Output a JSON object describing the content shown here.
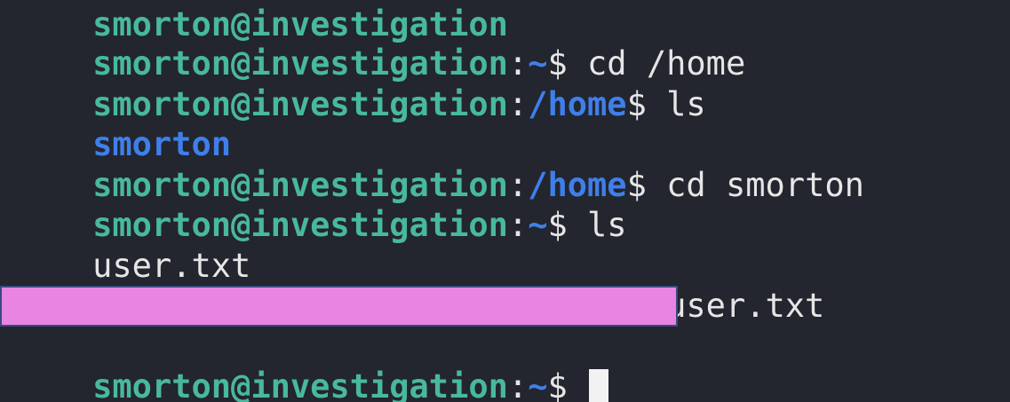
{
  "prompt": {
    "user_host": "smorton@investigation",
    "colon": ":",
    "dollar": "$"
  },
  "lines": [
    {
      "path": "~",
      "cmd": " cd /home"
    },
    {
      "path": "/home",
      "cmd": " ls"
    },
    {
      "output": "smorton"
    },
    {
      "path": "/home",
      "cmd": " cd smorton"
    },
    {
      "path": "~",
      "cmd": " ls"
    },
    {
      "output": "user.txt"
    },
    {
      "path": "~",
      "cmd": " cat user.txt"
    },
    {
      "path": "~",
      "cmd": " "
    }
  ],
  "colors": {
    "background": "#23252f",
    "user_host": "#48b99b",
    "path": "#3f7fea",
    "text": "#e6e6e6",
    "redaction": "#e885e3",
    "redaction_border": "#3b4a82"
  }
}
